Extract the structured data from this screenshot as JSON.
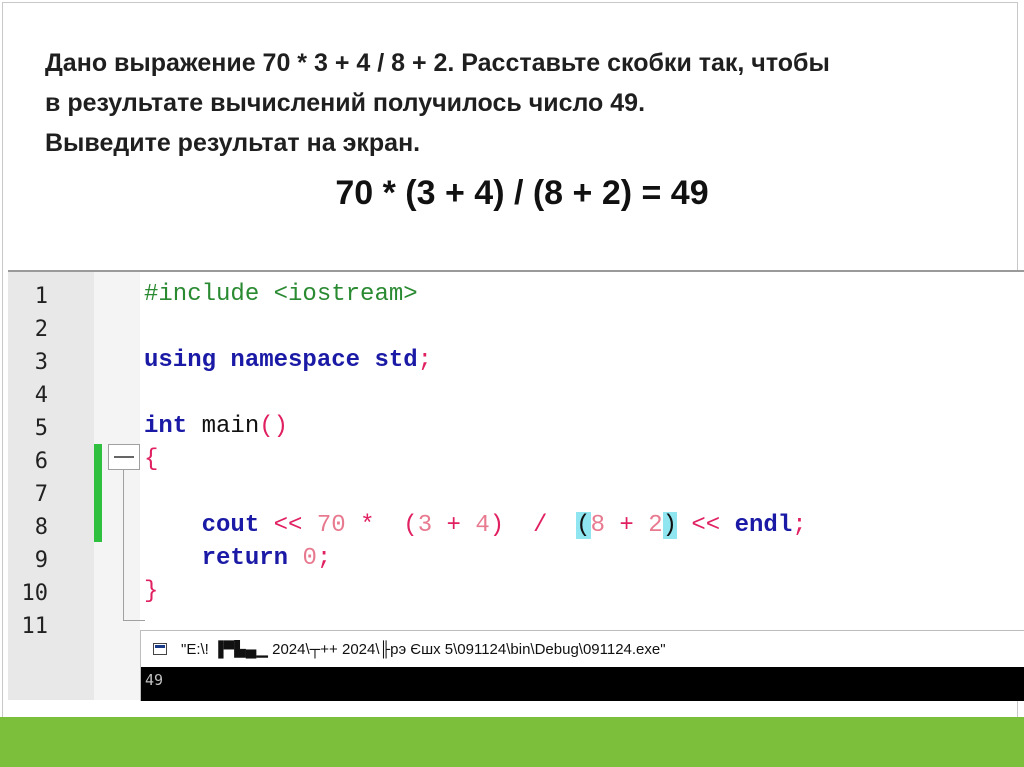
{
  "task": {
    "line1": "Дано выражение 70 * 3 + 4 / 8 + 2. Расставьте скобки так, чтобы",
    "line2": "в результате вычислений получилось число 49.",
    "line3": "Выведите результат на экран.",
    "answer": "70 * (3 + 4) / (8 + 2) = 49"
  },
  "editor": {
    "line_numbers": [
      "1",
      "2",
      "3",
      "4",
      "5",
      "6",
      "7",
      "8",
      "9",
      "10",
      "11"
    ],
    "code": {
      "l1": "#include <iostream>",
      "l3_kw1": "using",
      "l3_kw2": "namespace",
      "l3_kw3": "std",
      "l3_semi": ";",
      "l5_kw": "int",
      "l5_id": "main",
      "l5_parens": "()",
      "l6": "{",
      "l8_kw": "cout",
      "l8_op1": "<<",
      "l8_num1": "70",
      "l8_op2": "*",
      "l8_grp1_open": "(",
      "l8_num2": "3",
      "l8_op3": "+",
      "l8_num3": "4",
      "l8_grp1_close": ")",
      "l8_op4": "/",
      "l8_grp2_open": "(",
      "l8_num4": "8",
      "l8_op5": "+",
      "l8_num5": "2",
      "l8_grp2_close": ")",
      "l8_op6": "<<",
      "l8_endl": "endl",
      "l8_semi": ";",
      "l9_kw": "return",
      "l9_num": "0",
      "l9_semi": ";",
      "l10": "}"
    }
  },
  "console": {
    "title": "\"E:\\!  ▐▀▙▄▁ 2024\\┬++ 2024\\╟рэ Єшх 5\\091124\\bin\\Debug\\091124.exe\"",
    "output": "49"
  },
  "colors": {
    "footer": "#7bbf3a",
    "change_bar": "#2ec03e",
    "keyword": "#1a1aa6",
    "preprocessor": "#2a8a32",
    "operator": "#e02060",
    "number": "#e87a90",
    "bracket_highlight": "#8fe6f0"
  },
  "icons": {
    "console_icon": "console-window-icon",
    "fold_toggle": "fold-minus-icon"
  }
}
